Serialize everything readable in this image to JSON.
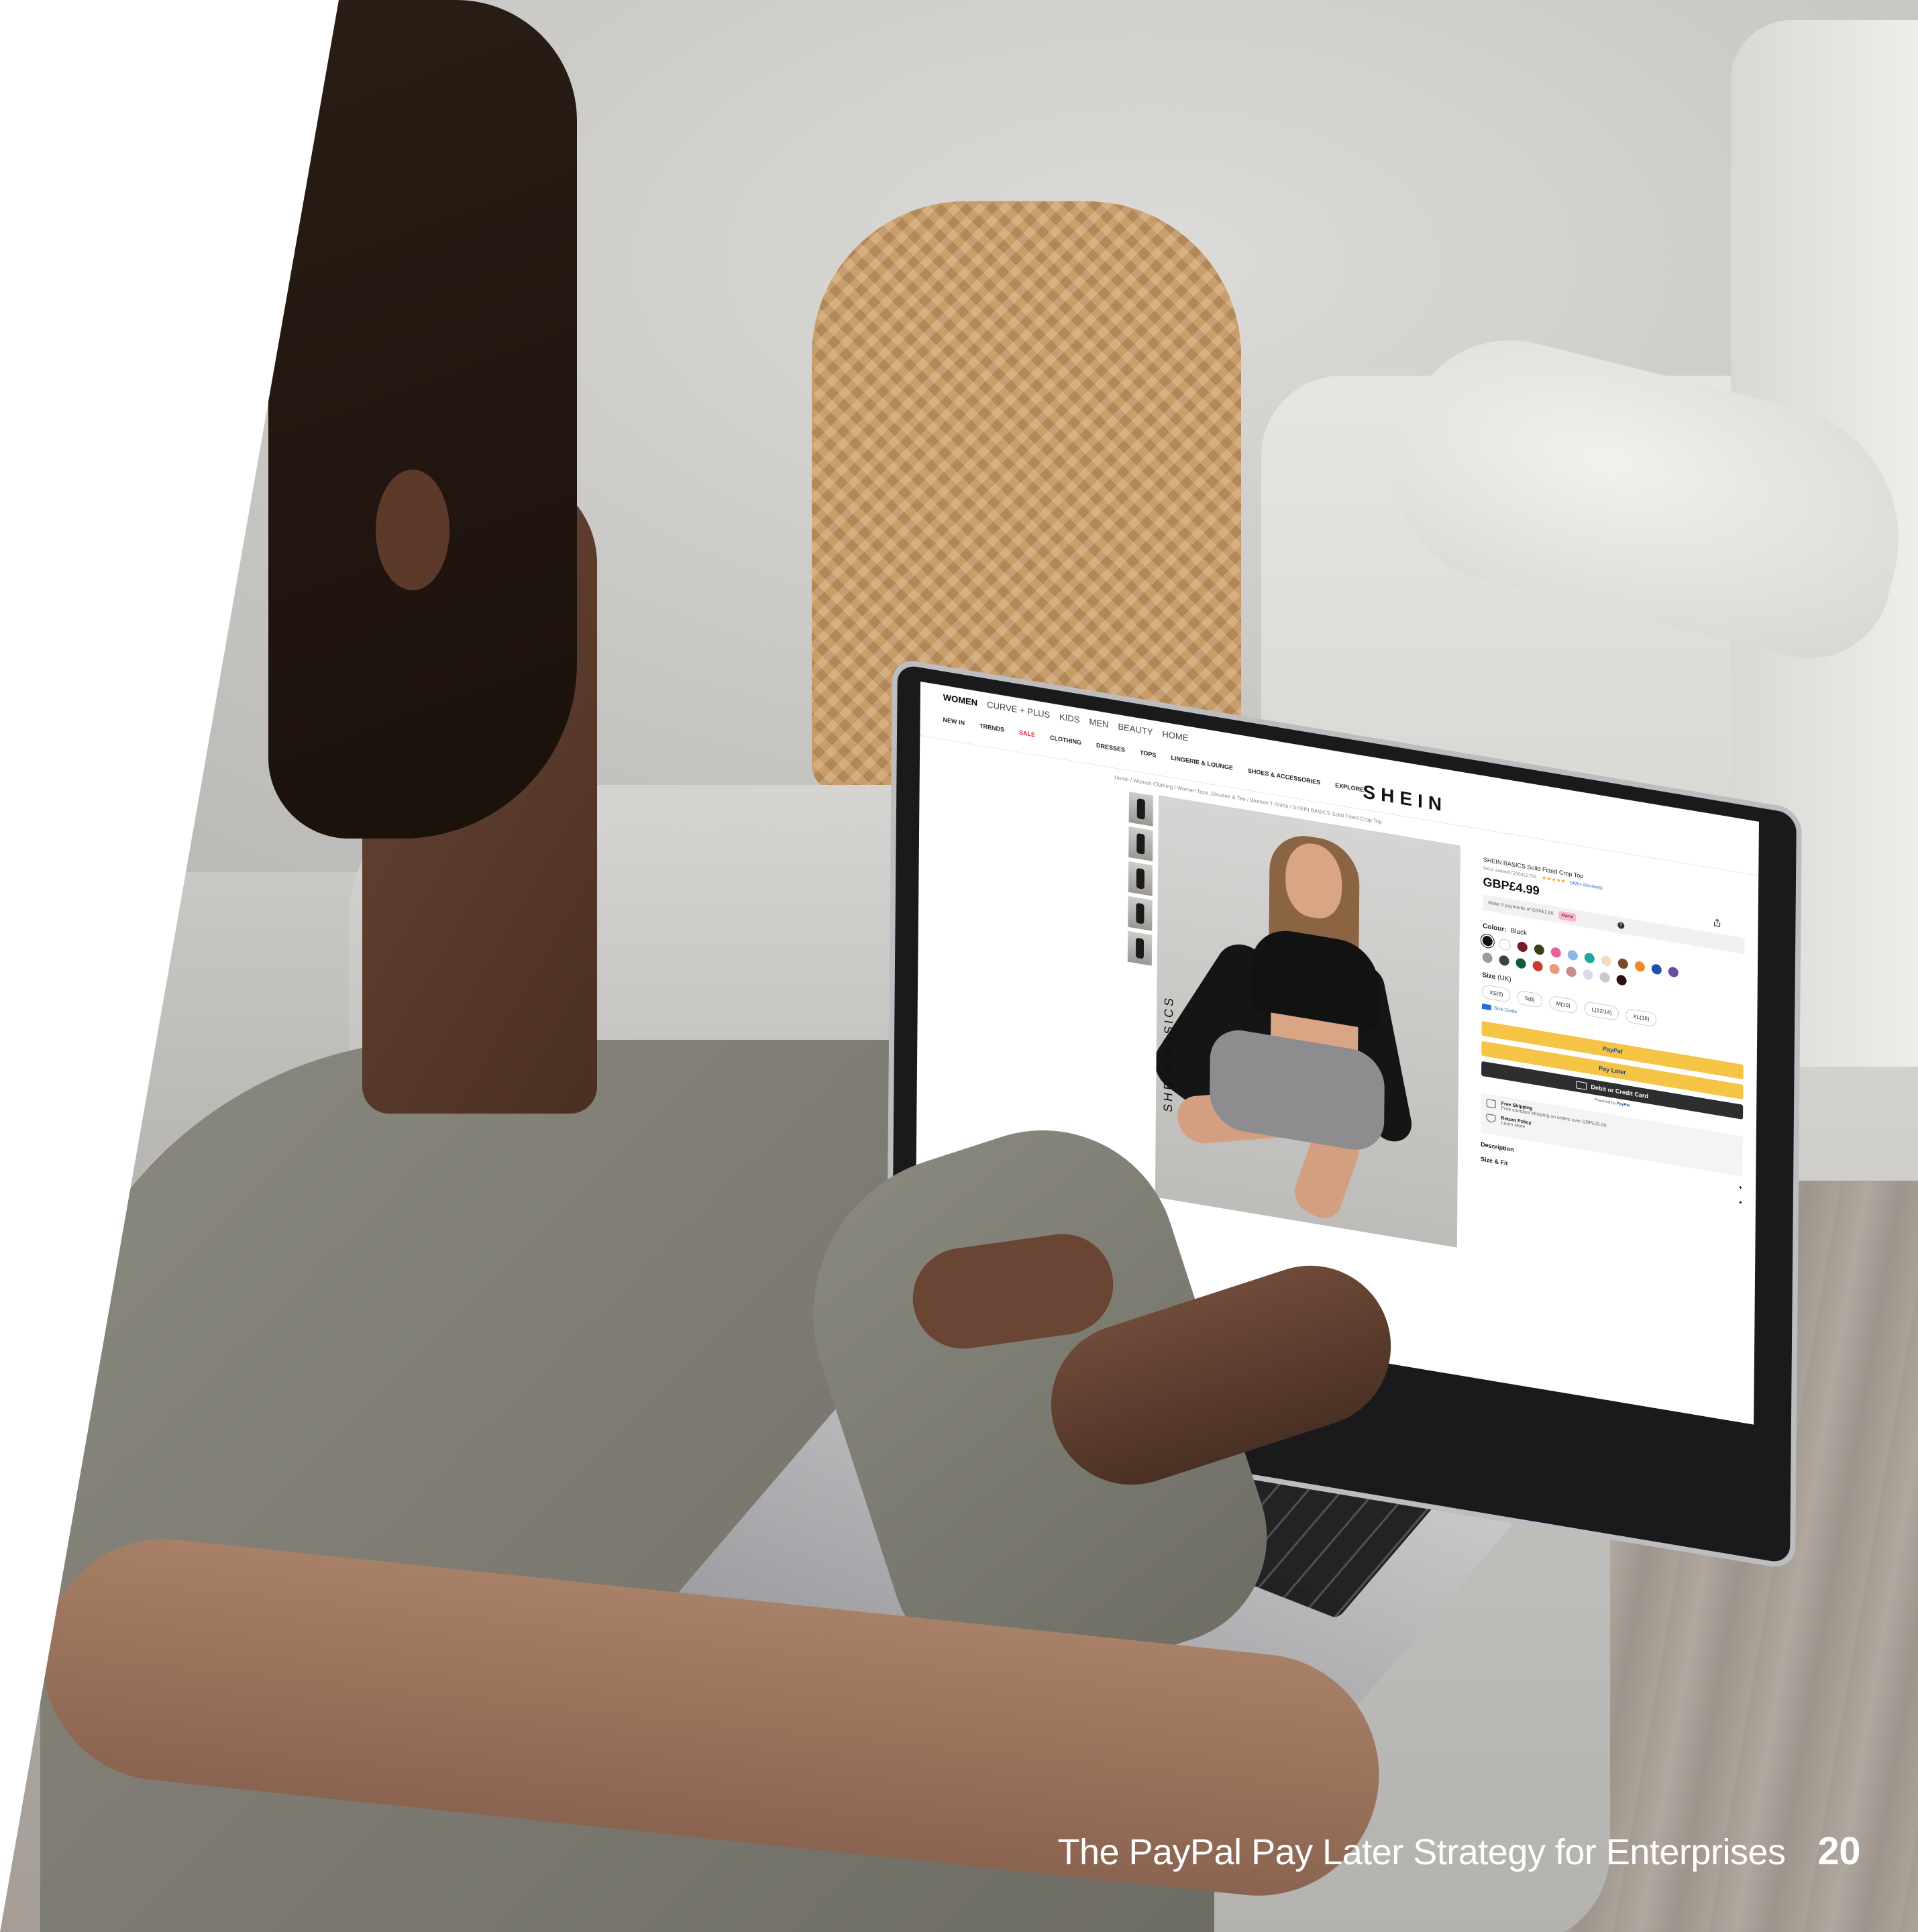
{
  "footer": {
    "title": "The PayPal Pay Later Strategy for Enterprises",
    "page_number": "20"
  },
  "laptop_screen": {
    "top_nav": [
      "WOMEN",
      "CURVE + PLUS",
      "KIDS",
      "MEN",
      "BEAUTY",
      "HOME"
    ],
    "category_nav": [
      "NEW IN",
      "TRENDS",
      "SALE",
      "CLOTHING",
      "DRESSES",
      "TOPS",
      "LINGERIE & LOUNGE",
      "SHOES & ACCESSORIES",
      "EXPLORE"
    ],
    "logo": "SHEIN",
    "breadcrumb": "Home / Women Clothing / Women Tops, Blouses & Tee / Women T-Shirts / SHEIN BASICS Solid Fitted Crop Top",
    "hero_brand": "SHEIN BASICS",
    "product": {
      "title": "SHEIN BASICS Solid Fitted Crop Top",
      "sku": "SKU: swtee07200422763",
      "stars": "★★★★★",
      "reviews": "(999+ Reviews)",
      "price": "GBP£4.99",
      "installments": "Make 3 payments of GBP£1.66",
      "installments_badge": "Klarna"
    },
    "colour": {
      "label": "Colour:",
      "value": "Black"
    },
    "swatches": [
      "#111111",
      "#ffffff",
      "#7a1d2a",
      "#3a3f1e",
      "#e9609a",
      "#8ab8e6",
      "#1fa79a",
      "#f2d9c2",
      "#7a4a2e",
      "#f08a1f",
      "#1f4fa8",
      "#6a4aa0",
      "#9b9b9b",
      "#3a3f4a",
      "#0f5a3a",
      "#c93a2e",
      "#e89a7a",
      "#c98a8a",
      "#e2d6ee",
      "#c9c9c9",
      "#2a1010"
    ],
    "size": {
      "label": "Size",
      "unit": "(UK)",
      "options": [
        "XS(6)",
        "S(8)",
        "M(10)",
        "L(12/14)",
        "XL(16)"
      ],
      "guide": "Size Guide"
    },
    "buttons": {
      "paypal": "PayPal",
      "paylater": "Pay Later",
      "card": "Debit or Credit Card",
      "powered_prefix": "Powered by",
      "powered_brand": "PayPal"
    },
    "services": [
      {
        "title": "Free Shipping",
        "detail": "Free standard shipping on orders over GBP£35.00"
      },
      {
        "title": "Return Policy",
        "detail": "Learn More"
      }
    ],
    "accordions": [
      "Description",
      "Size & Fit"
    ]
  }
}
